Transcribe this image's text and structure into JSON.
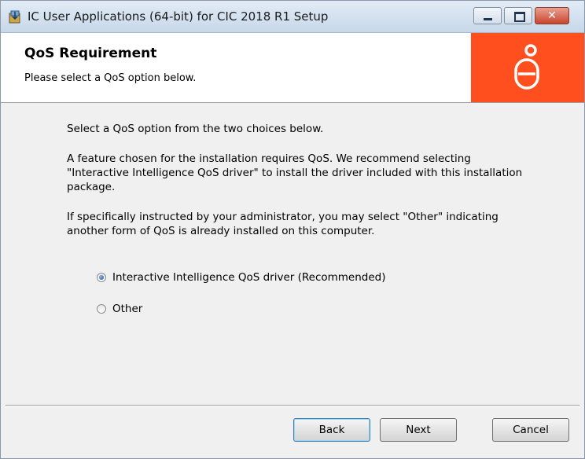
{
  "window": {
    "title": "IC User Applications (64-bit) for CIC 2018 R1 Setup",
    "close_glyph": "✕",
    "icon": "installer-icon"
  },
  "banner": {
    "title": "QoS Requirement",
    "subtitle": "Please select a QoS option below.",
    "logo_color": "#ff4f1f"
  },
  "content": {
    "intro": "Select a QoS option from the two choices below.",
    "recommendation": "A feature chosen for the installation requires QoS. We recommend selecting \"Interactive Intelligence QoS driver\" to install the driver included with this installation package.",
    "other_note": "If specifically instructed by your administrator, you may select \"Other\" indicating another form of QoS is already installed on this computer.",
    "options": [
      {
        "label": "Interactive Intelligence QoS driver (Recommended)",
        "selected": true
      },
      {
        "label": "Other",
        "selected": false
      }
    ]
  },
  "footer": {
    "back_label": "Back",
    "next_label": "Next",
    "cancel_label": "Cancel"
  }
}
